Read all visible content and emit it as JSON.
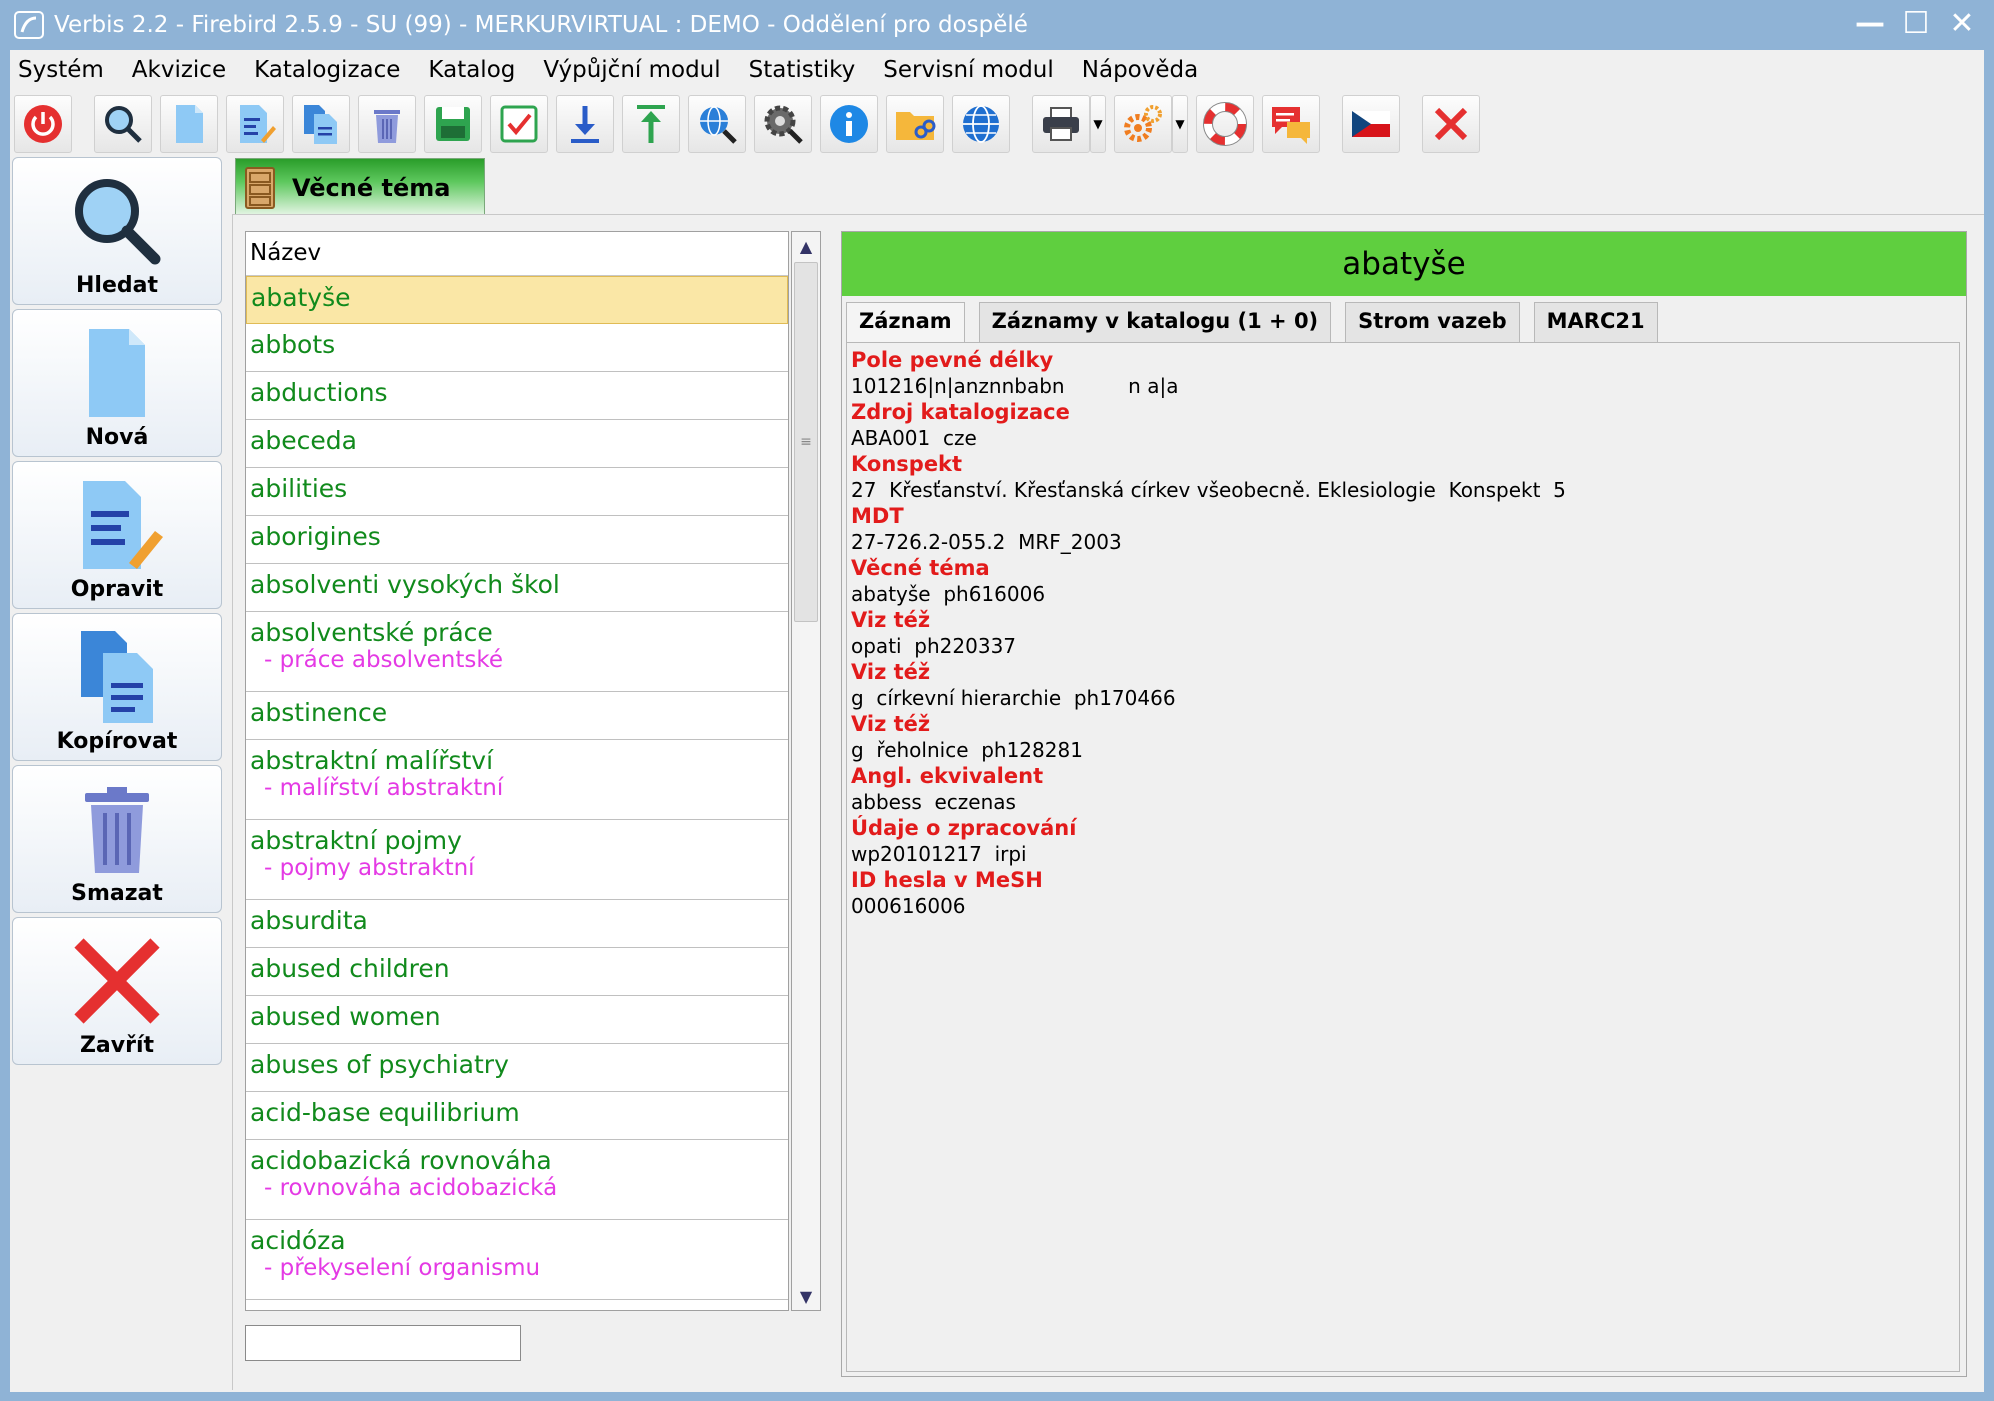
{
  "window": {
    "title": "Verbis 2.2 - Firebird 2.5.9 - SU (99) - MERKURVIRTUAL : DEMO - Oddělení pro dospělé"
  },
  "menu": [
    "Systém",
    "Akvizice",
    "Katalogizace",
    "Katalog",
    "Výpůjční modul",
    "Statistiky",
    "Servisní modul",
    "Nápověda"
  ],
  "side_buttons": {
    "search": "Hledat",
    "new": "Nová",
    "edit": "Opravit",
    "copy": "Kopírovat",
    "delete": "Smazat",
    "close": "Zavřít"
  },
  "tab": {
    "label": "Věcné téma"
  },
  "list": {
    "header": "Název",
    "items": [
      {
        "title": "abatyše",
        "sub": ""
      },
      {
        "title": "abbots",
        "sub": ""
      },
      {
        "title": "abductions",
        "sub": ""
      },
      {
        "title": "abeceda",
        "sub": ""
      },
      {
        "title": "abilities",
        "sub": ""
      },
      {
        "title": "aborigines",
        "sub": ""
      },
      {
        "title": "absolventi vysokých škol",
        "sub": ""
      },
      {
        "title": "absolventské práce",
        "sub": "- práce absolventské"
      },
      {
        "title": "abstinence",
        "sub": ""
      },
      {
        "title": "abstraktní malířství",
        "sub": "- malířství abstraktní"
      },
      {
        "title": "abstraktní pojmy",
        "sub": "- pojmy abstraktní"
      },
      {
        "title": "absurdita",
        "sub": ""
      },
      {
        "title": "abused children",
        "sub": ""
      },
      {
        "title": "abused women",
        "sub": ""
      },
      {
        "title": "abuses of psychiatry",
        "sub": ""
      },
      {
        "title": "acid-base equilibrium",
        "sub": ""
      },
      {
        "title": "acidobazická rovnováha",
        "sub": "- rovnováha acidobazická"
      },
      {
        "title": "acidóza",
        "sub": "- překyselení organismu"
      }
    ],
    "search_value": ""
  },
  "detail": {
    "title": "abatyše",
    "tabs": [
      "Záznam",
      "Záznamy v katalogu (1 + 0)",
      "Strom vazeb",
      "MARC21"
    ],
    "fields": [
      {
        "label": "Pole pevné délky",
        "value": "101216|n|anznnbabn          n a|a"
      },
      {
        "label": "Zdroj katalogizace",
        "value": "ABA001  cze"
      },
      {
        "label": "Konspekt",
        "value": "27  Křesťanství. Křesťanská církev všeobecně. Eklesiologie  Konspekt  5"
      },
      {
        "label": "MDT",
        "value": "27-726.2-055.2  MRF_2003"
      },
      {
        "label": "Věcné téma",
        "value": "abatyše  ph616006"
      },
      {
        "label": "Viz též",
        "value": "opati  ph220337"
      },
      {
        "label": "Viz též",
        "value": "g  církevní hierarchie  ph170466"
      },
      {
        "label": "Viz též",
        "value": "g  řeholnice  ph128281"
      },
      {
        "label": "Angl. ekvivalent",
        "value": "abbess  eczenas"
      },
      {
        "label": "Údaje o zpracování",
        "value": "wp20101217  irpi"
      },
      {
        "label": "ID hesla v MeSH",
        "value": "000616006"
      }
    ]
  },
  "colors": {
    "header_green": "#5fcf3f",
    "item_green": "#118a1c",
    "sub_magenta": "#e43ae4",
    "field_red": "#e21b1b",
    "selection": "#fae7a6"
  },
  "icons": {
    "toolbar": [
      "power-icon",
      "search-icon",
      "new-doc-icon",
      "edit-doc-icon",
      "copy-doc-icon",
      "trash-icon",
      "save-icon",
      "check-icon",
      "download-icon",
      "upload-icon",
      "globe-search-icon",
      "gear-search-icon",
      "info-icon",
      "folder-link-icon",
      "globe-icon",
      "printer-icon",
      "gears-icon",
      "lifebuoy-icon",
      "chat-icon",
      "czech-flag-icon",
      "close-icon"
    ]
  }
}
